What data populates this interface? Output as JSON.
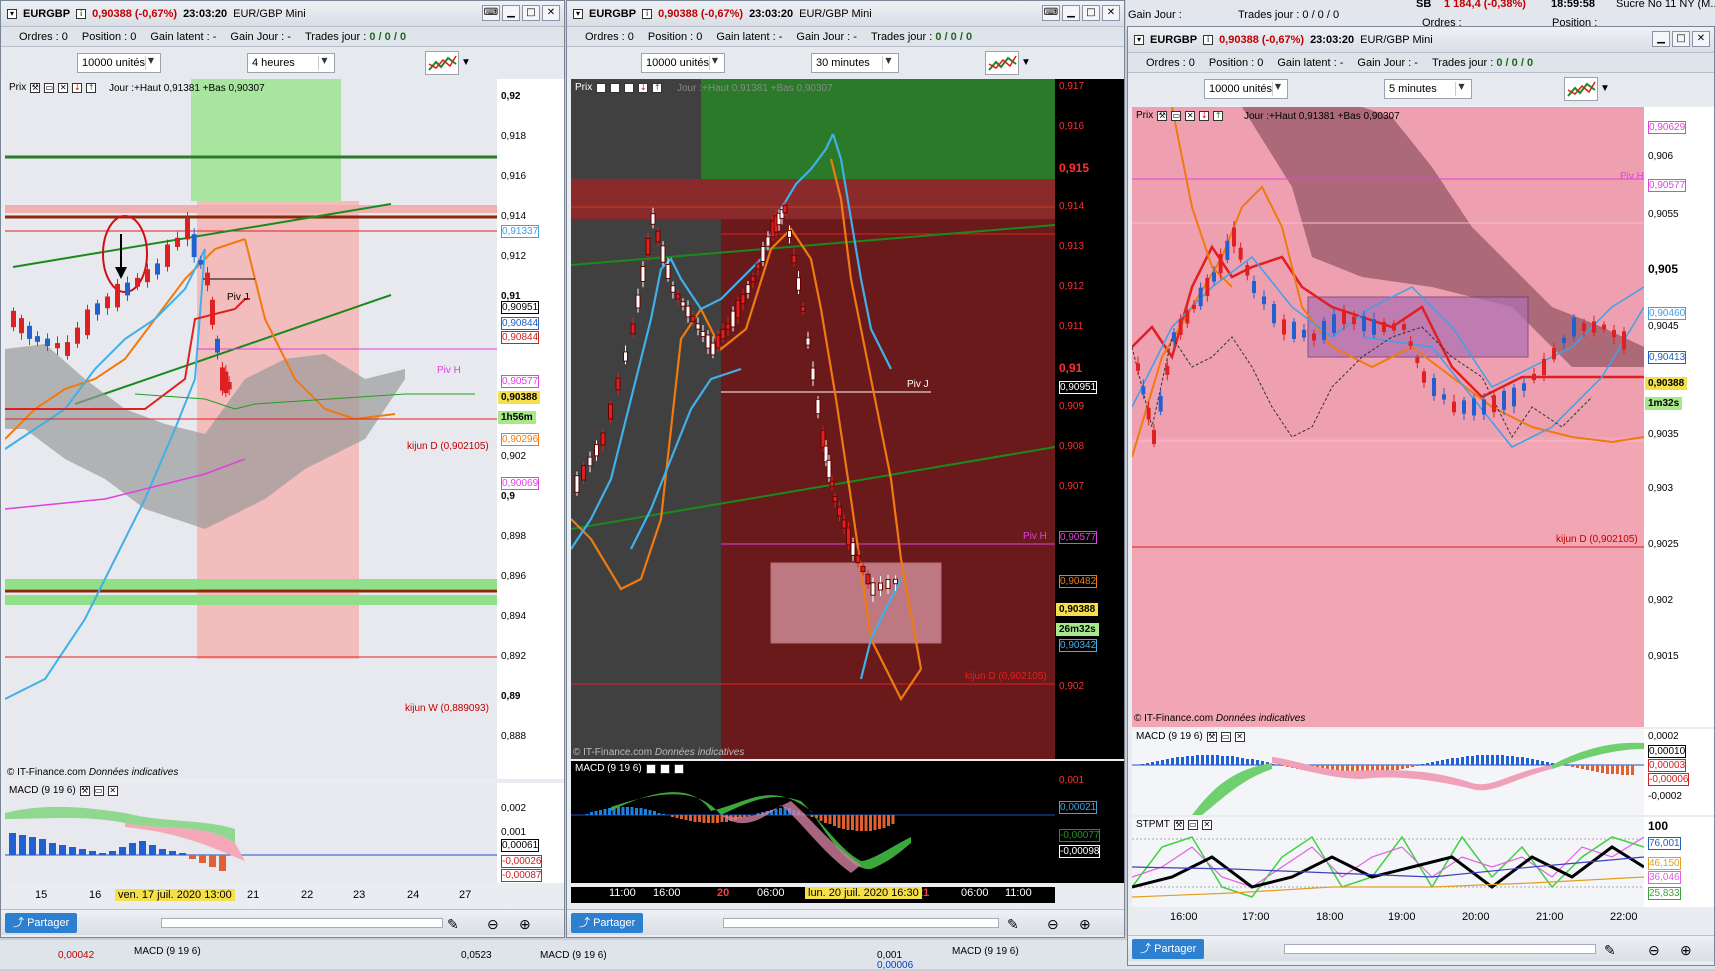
{
  "common": {
    "symbol": "EURGBP",
    "change": "0,90388 (-0,67%)",
    "time": "23:03:20",
    "instrument": "EUR/GBP Mini",
    "ordres_label": "Ordres :",
    "ordres_value": "0",
    "position_label": "Position :",
    "position_value": "0",
    "gain_latent_label": "Gain latent :",
    "gain_latent_value": "-",
    "gain_jour_label": "Gain Jour :",
    "gain_jour_value": "-",
    "trades_jour_label": "Trades jour :",
    "trades_jour_value": "0 / 0 / 0",
    "units": "10000 unités",
    "prix_label": "Prix",
    "jour_info": "Jour :+Haut 0,91381 +Bas 0,90307",
    "copyright": "© IT-Finance.com",
    "donnees": "Données indicatives",
    "partager": "Partager",
    "macd_label": "MACD (9 19 6)",
    "stpmt_label": "STPMT",
    "last_price": "0,90388"
  },
  "left": {
    "timeframe": "4 heures",
    "countdown": "1h56m",
    "y_ticks": [
      "0,92",
      "0,918",
      "0,916",
      "0,914",
      "0,912",
      "0,91",
      "0,908",
      "0,906",
      "0,904",
      "0,902",
      "0,9",
      "0,898",
      "0,896",
      "0,894",
      "0,892",
      "0,89",
      "0,888"
    ],
    "tags": [
      "0,91337",
      "0,90951",
      "0,90844",
      "0,90844",
      "0,90577",
      "0,90296",
      "0,90069"
    ],
    "piv_j": "Piv J",
    "piv_h": "Piv H",
    "kijun_d": "kijun D (0,902105)",
    "kijun_w": "kijun W (0,889093)",
    "macd_ticks": [
      "0,002",
      "0,001",
      "0,00061",
      "-0,00026",
      "-0,00087"
    ],
    "x_labels": [
      "15",
      "16",
      "21",
      "22",
      "23",
      "24",
      "27"
    ],
    "date_tag": "ven. 17 juil. 2020 13:00"
  },
  "middle": {
    "timeframe": "30 minutes",
    "countdown": "26m32s",
    "y_ticks": [
      "0,917",
      "0,916",
      "0,915",
      "0,914",
      "0,913",
      "0,912",
      "0,911",
      "0,91",
      "0,909",
      "0,908",
      "0,907",
      "0,906",
      "0,905",
      "0,904",
      "0,903",
      "0,902"
    ],
    "tags": [
      "0,90951",
      "0,90577",
      "0,90482",
      "0,90342"
    ],
    "piv_j": "Piv J",
    "piv_h": "Piv H",
    "kijun_d": "kijun D (0,902105)",
    "macd_ticks": [
      "0,001",
      "0,00021",
      "-0,00077",
      "-0,00098"
    ],
    "x_labels": [
      "11:00",
      "16:00",
      "20",
      "06:00",
      "21",
      "06:00",
      "11:00"
    ],
    "date_tag": "lun. 20 juil. 2020 16:30"
  },
  "right": {
    "timeframe": "5 minutes",
    "countdown": "1m32s",
    "y_ticks": [
      "0,90629",
      "0,906",
      "0,90577",
      "0,9055",
      "0,905",
      "0,90460",
      "0,9045",
      "0,90413",
      "0,9035",
      "0,903",
      "0,9025",
      "0,902",
      "0,9015"
    ],
    "piv_h": "Piv H",
    "kijun_d": "kijun D (0,902105)",
    "macd_ticks": [
      "0,0002",
      "0,00010",
      "0,00003",
      "-0,00006",
      "-0,0002"
    ],
    "stpmt_ticks": [
      "100",
      "76,001",
      "46,150",
      "36,046",
      "25,833"
    ],
    "x_labels": [
      "16:00",
      "17:00",
      "18:00",
      "19:00",
      "20:00",
      "21:00",
      "22:00"
    ]
  },
  "background_window": {
    "item1": "SB",
    "item1_change": "1 184,4 (-0,38%)",
    "item1_time": "18:59:58",
    "item1_name": "Sucre No 11 NY (M...",
    "gain_jour": "Gain Jour :",
    "trades_jour": "Trades jour : 0 / 0 / 0",
    "ordres": "Ordres :",
    "position": "Position :",
    "bottom_values": [
      "0,00042",
      "0,0523",
      "0,001",
      "0,00006"
    ]
  }
}
